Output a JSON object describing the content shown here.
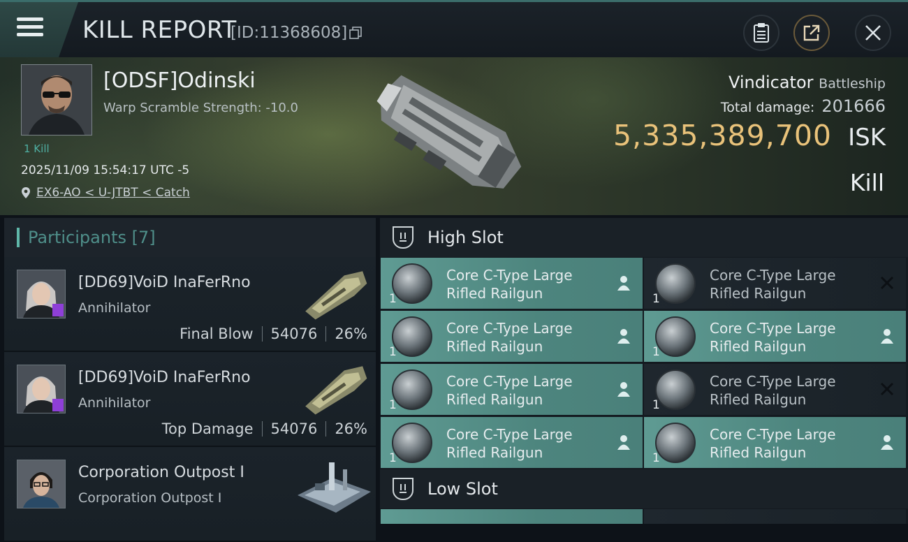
{
  "header": {
    "title": "KILL REPORT",
    "report_id": "[ID:11368608]"
  },
  "victim": {
    "name": "[ODSF]Odinski",
    "warp_scramble": "Warp Scramble Strength: -10.0",
    "kill_count": "1 Kill",
    "timestamp": "2025/11/09 15:54:17 UTC -5",
    "location": "EX6-AO < U-JTBT < Catch",
    "ship_name": "Vindicator",
    "ship_class": "Battleship",
    "total_damage_label": "Total damage:",
    "total_damage": "201666",
    "isk_value": "5,335,389,700",
    "isk_unit": "ISK",
    "result": "Kill"
  },
  "participants": {
    "label": "Participants [7]",
    "items": [
      {
        "name": "[DD69]VoiD InaFerRno",
        "ship": "Annihilator",
        "role": "Final Blow",
        "damage": "54076",
        "percent": "26%"
      },
      {
        "name": "[DD69]VoiD InaFerRno",
        "ship": "Annihilator",
        "role": "Top Damage",
        "damage": "54076",
        "percent": "26%"
      },
      {
        "name": "Corporation Outpost I",
        "ship": "Corporation Outpost I"
      }
    ]
  },
  "fitting": {
    "high_slot_label": "High Slot",
    "low_slot_label": "Low Slot",
    "high_modules": [
      {
        "line1": "Core C-Type Large",
        "line2": "Rifled Railgun",
        "qty": "1",
        "state": "fitted"
      },
      {
        "line1": "Core C-Type Large",
        "line2": "Rifled Railgun",
        "qty": "1",
        "state": "destroyed"
      },
      {
        "line1": "Core C-Type Large",
        "line2": "Rifled Railgun",
        "qty": "1",
        "state": "fitted"
      },
      {
        "line1": "Core C-Type Large",
        "line2": "Rifled Railgun",
        "qty": "1",
        "state": "fitted"
      },
      {
        "line1": "Core C-Type Large",
        "line2": "Rifled Railgun",
        "qty": "1",
        "state": "fitted"
      },
      {
        "line1": "Core C-Type Large",
        "line2": "Rifled Railgun",
        "qty": "1",
        "state": "destroyed"
      },
      {
        "line1": "Core C-Type Large",
        "line2": "Rifled Railgun",
        "qty": "1",
        "state": "fitted"
      },
      {
        "line1": "Core C-Type Large",
        "line2": "Rifled Railgun",
        "qty": "1",
        "state": "fitted"
      }
    ]
  },
  "colors": {
    "accent_teal": "#5fb7a9",
    "isk_gold": "#e9c27a",
    "module_fitted": "#5f9b93",
    "rarity_purple": "#8e3fd8"
  }
}
